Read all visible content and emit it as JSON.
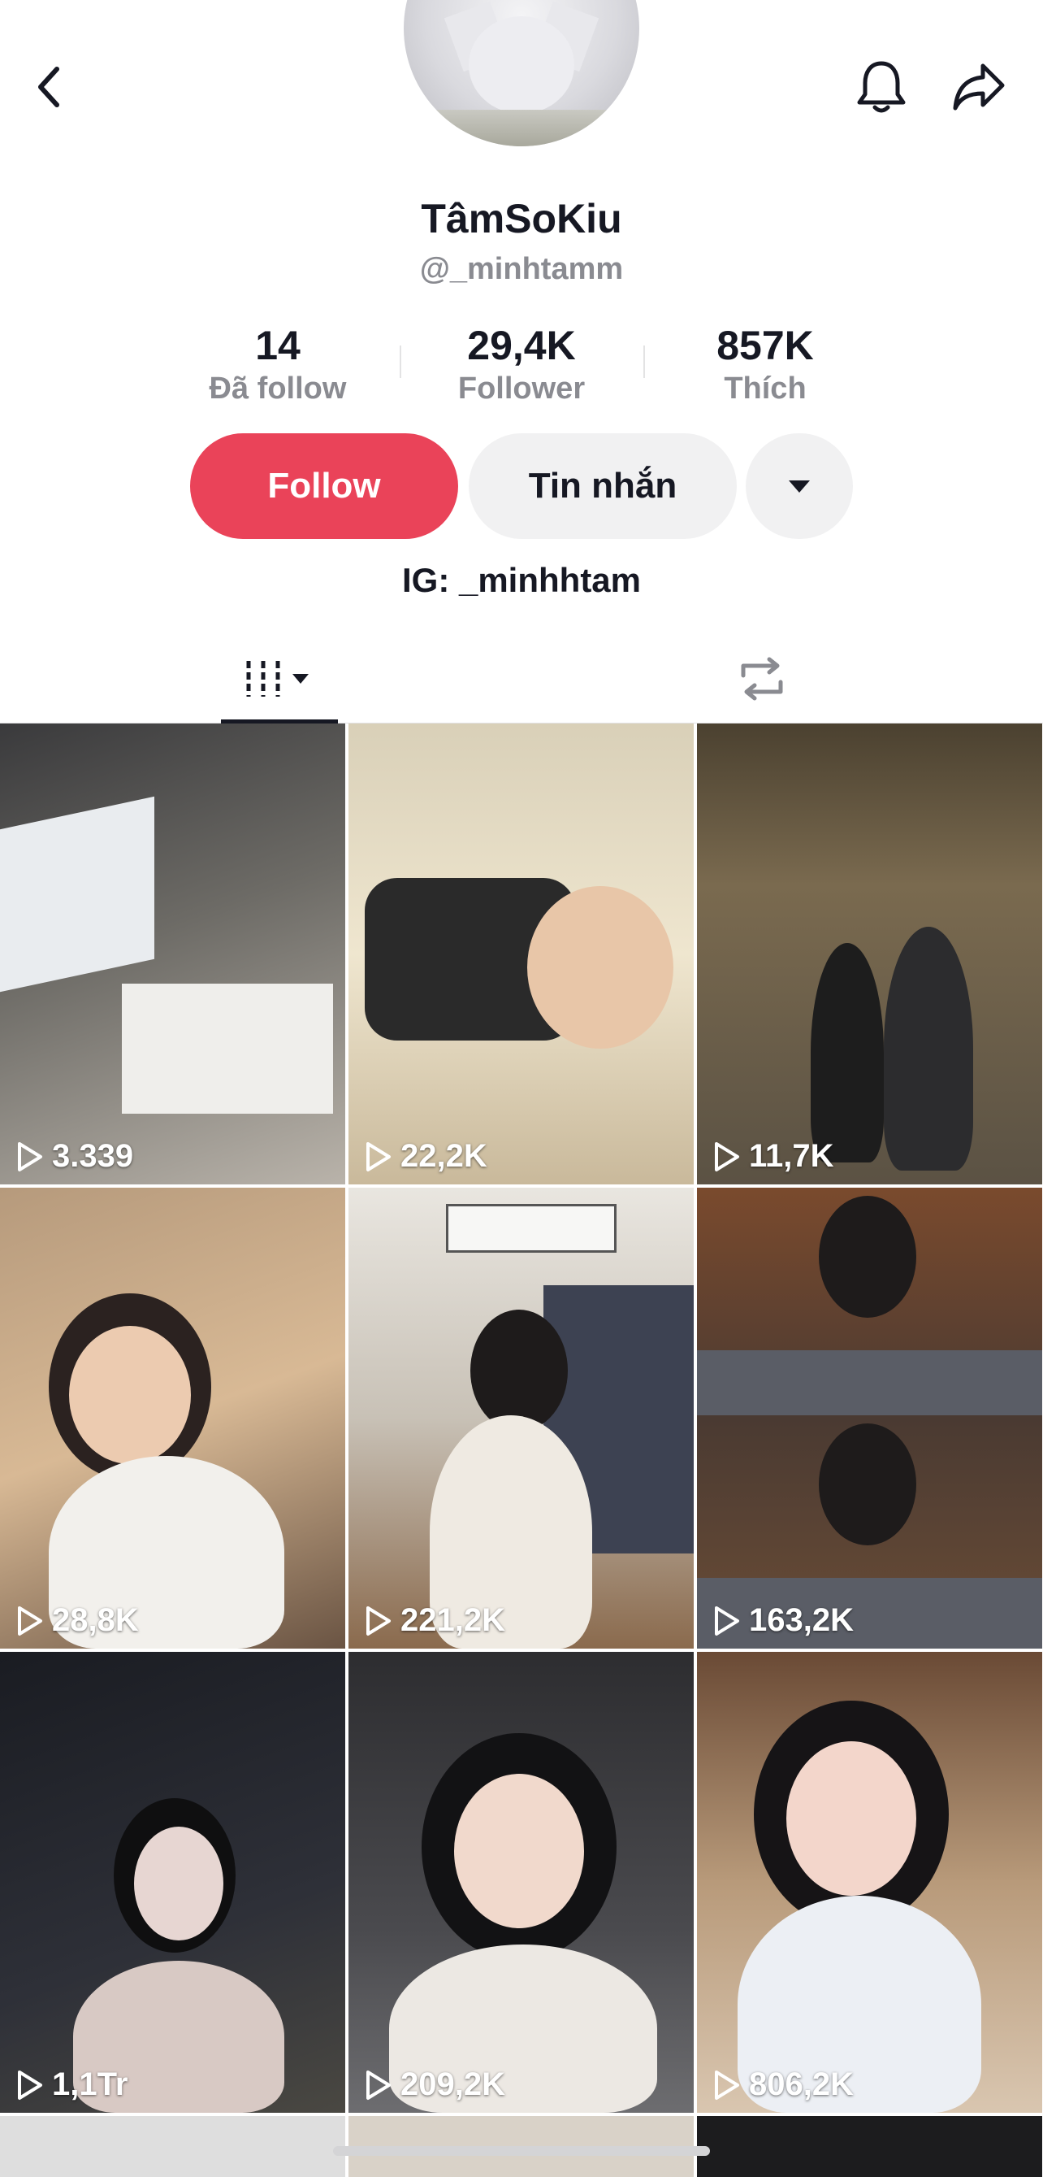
{
  "profile": {
    "display_name": "TâmSoKiu",
    "handle": "@_minhtamm",
    "bio": "IG: _minhhtam"
  },
  "stats": [
    {
      "value": "14",
      "label": "Đã follow"
    },
    {
      "value": "29,4K",
      "label": "Follower"
    },
    {
      "value": "857K",
      "label": "Thích"
    }
  ],
  "actions": {
    "follow_label": "Follow",
    "message_label": "Tin nhắn",
    "more_icon": "caret-down-icon"
  },
  "topbar": {
    "back_icon": "chevron-left-icon",
    "notification_icon": "bell-icon",
    "share_icon": "share-arrow-icon"
  },
  "tabs": [
    {
      "icon": "videos-grid-icon",
      "selected": true
    },
    {
      "icon": "repost-icon",
      "selected": false
    }
  ],
  "videos": [
    {
      "views": "3.339"
    },
    {
      "views": "22,2K"
    },
    {
      "views": "11,7K"
    },
    {
      "views": "28,8K"
    },
    {
      "views": "221,2K"
    },
    {
      "views": "163,2K"
    },
    {
      "views": "1,1Tr"
    },
    {
      "views": "209,2K"
    },
    {
      "views": "806,2K"
    }
  ],
  "colors": {
    "follow_button": "#ea4359",
    "secondary_button": "#f1f1f2",
    "muted_text": "#8a8b91"
  }
}
